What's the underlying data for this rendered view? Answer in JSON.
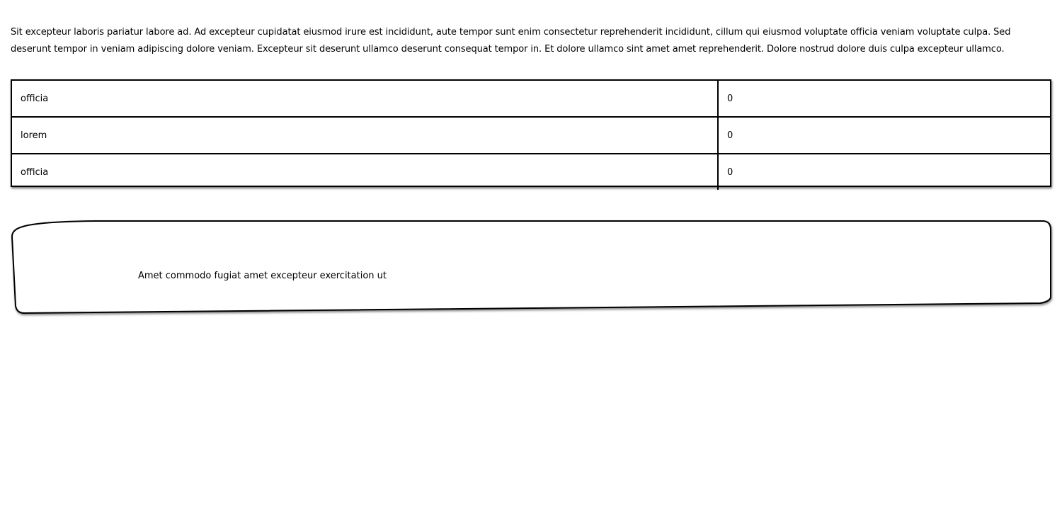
{
  "intro": {
    "paragraph": "Sit excepteur laboris pariatur labore ad. Ad excepteur cupidatat eiusmod irure est incididunt, aute tempor sunt enim consectetur reprehenderit incididunt, cillum qui eiusmod voluptate officia veniam voluptate culpa. Sed deserunt tempor in veniam adipiscing dolore veniam. Excepteur sit deserunt ullamco deserunt consequat tempor in. Et dolore ullamco sint amet amet reprehenderit. Dolore nostrud dolore duis culpa excepteur ullamco."
  },
  "table": {
    "rows": [
      {
        "label": "officia",
        "value": "0"
      },
      {
        "label": "lorem",
        "value": "0"
      },
      {
        "label": "officia",
        "value": "0"
      }
    ]
  },
  "card": {
    "text": "Amet commodo fugiat amet excepteur exercitation ut"
  }
}
